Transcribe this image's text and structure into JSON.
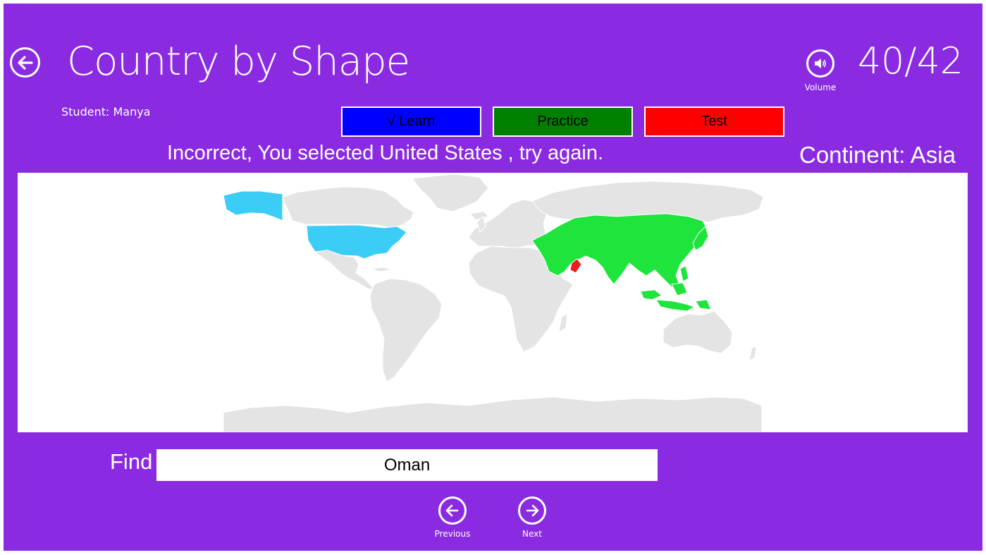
{
  "header": {
    "title": "Country by Shape",
    "score": "40/42",
    "volume_label": "Volume",
    "student": "Student: Manya"
  },
  "modes": {
    "learn": "√ Learn",
    "practice": "Practice",
    "test": "Test",
    "colors": {
      "learn": "#0000ff",
      "practice": "#008000",
      "test": "#ff0000"
    }
  },
  "status": {
    "feedback": "Incorrect, You selected United States , try again.",
    "continent": "Continent: Asia"
  },
  "map": {
    "highlight_continent": "Asia",
    "target_country": "Oman",
    "selected_country": "United States",
    "colors": {
      "land": "#e4e4e4",
      "continent": "#1ee43c",
      "target": "#ee1c1c",
      "selected": "#3ccdf6",
      "background": "#ffffff",
      "app_background": "#8a2be2"
    }
  },
  "find": {
    "label": "Find",
    "value": "Oman"
  },
  "nav": {
    "previous": "Previous",
    "next": "Next"
  },
  "icons": {
    "back": "back-arrow-icon",
    "volume": "speaker-icon",
    "previous": "left-arrow-icon",
    "next": "right-arrow-icon"
  }
}
